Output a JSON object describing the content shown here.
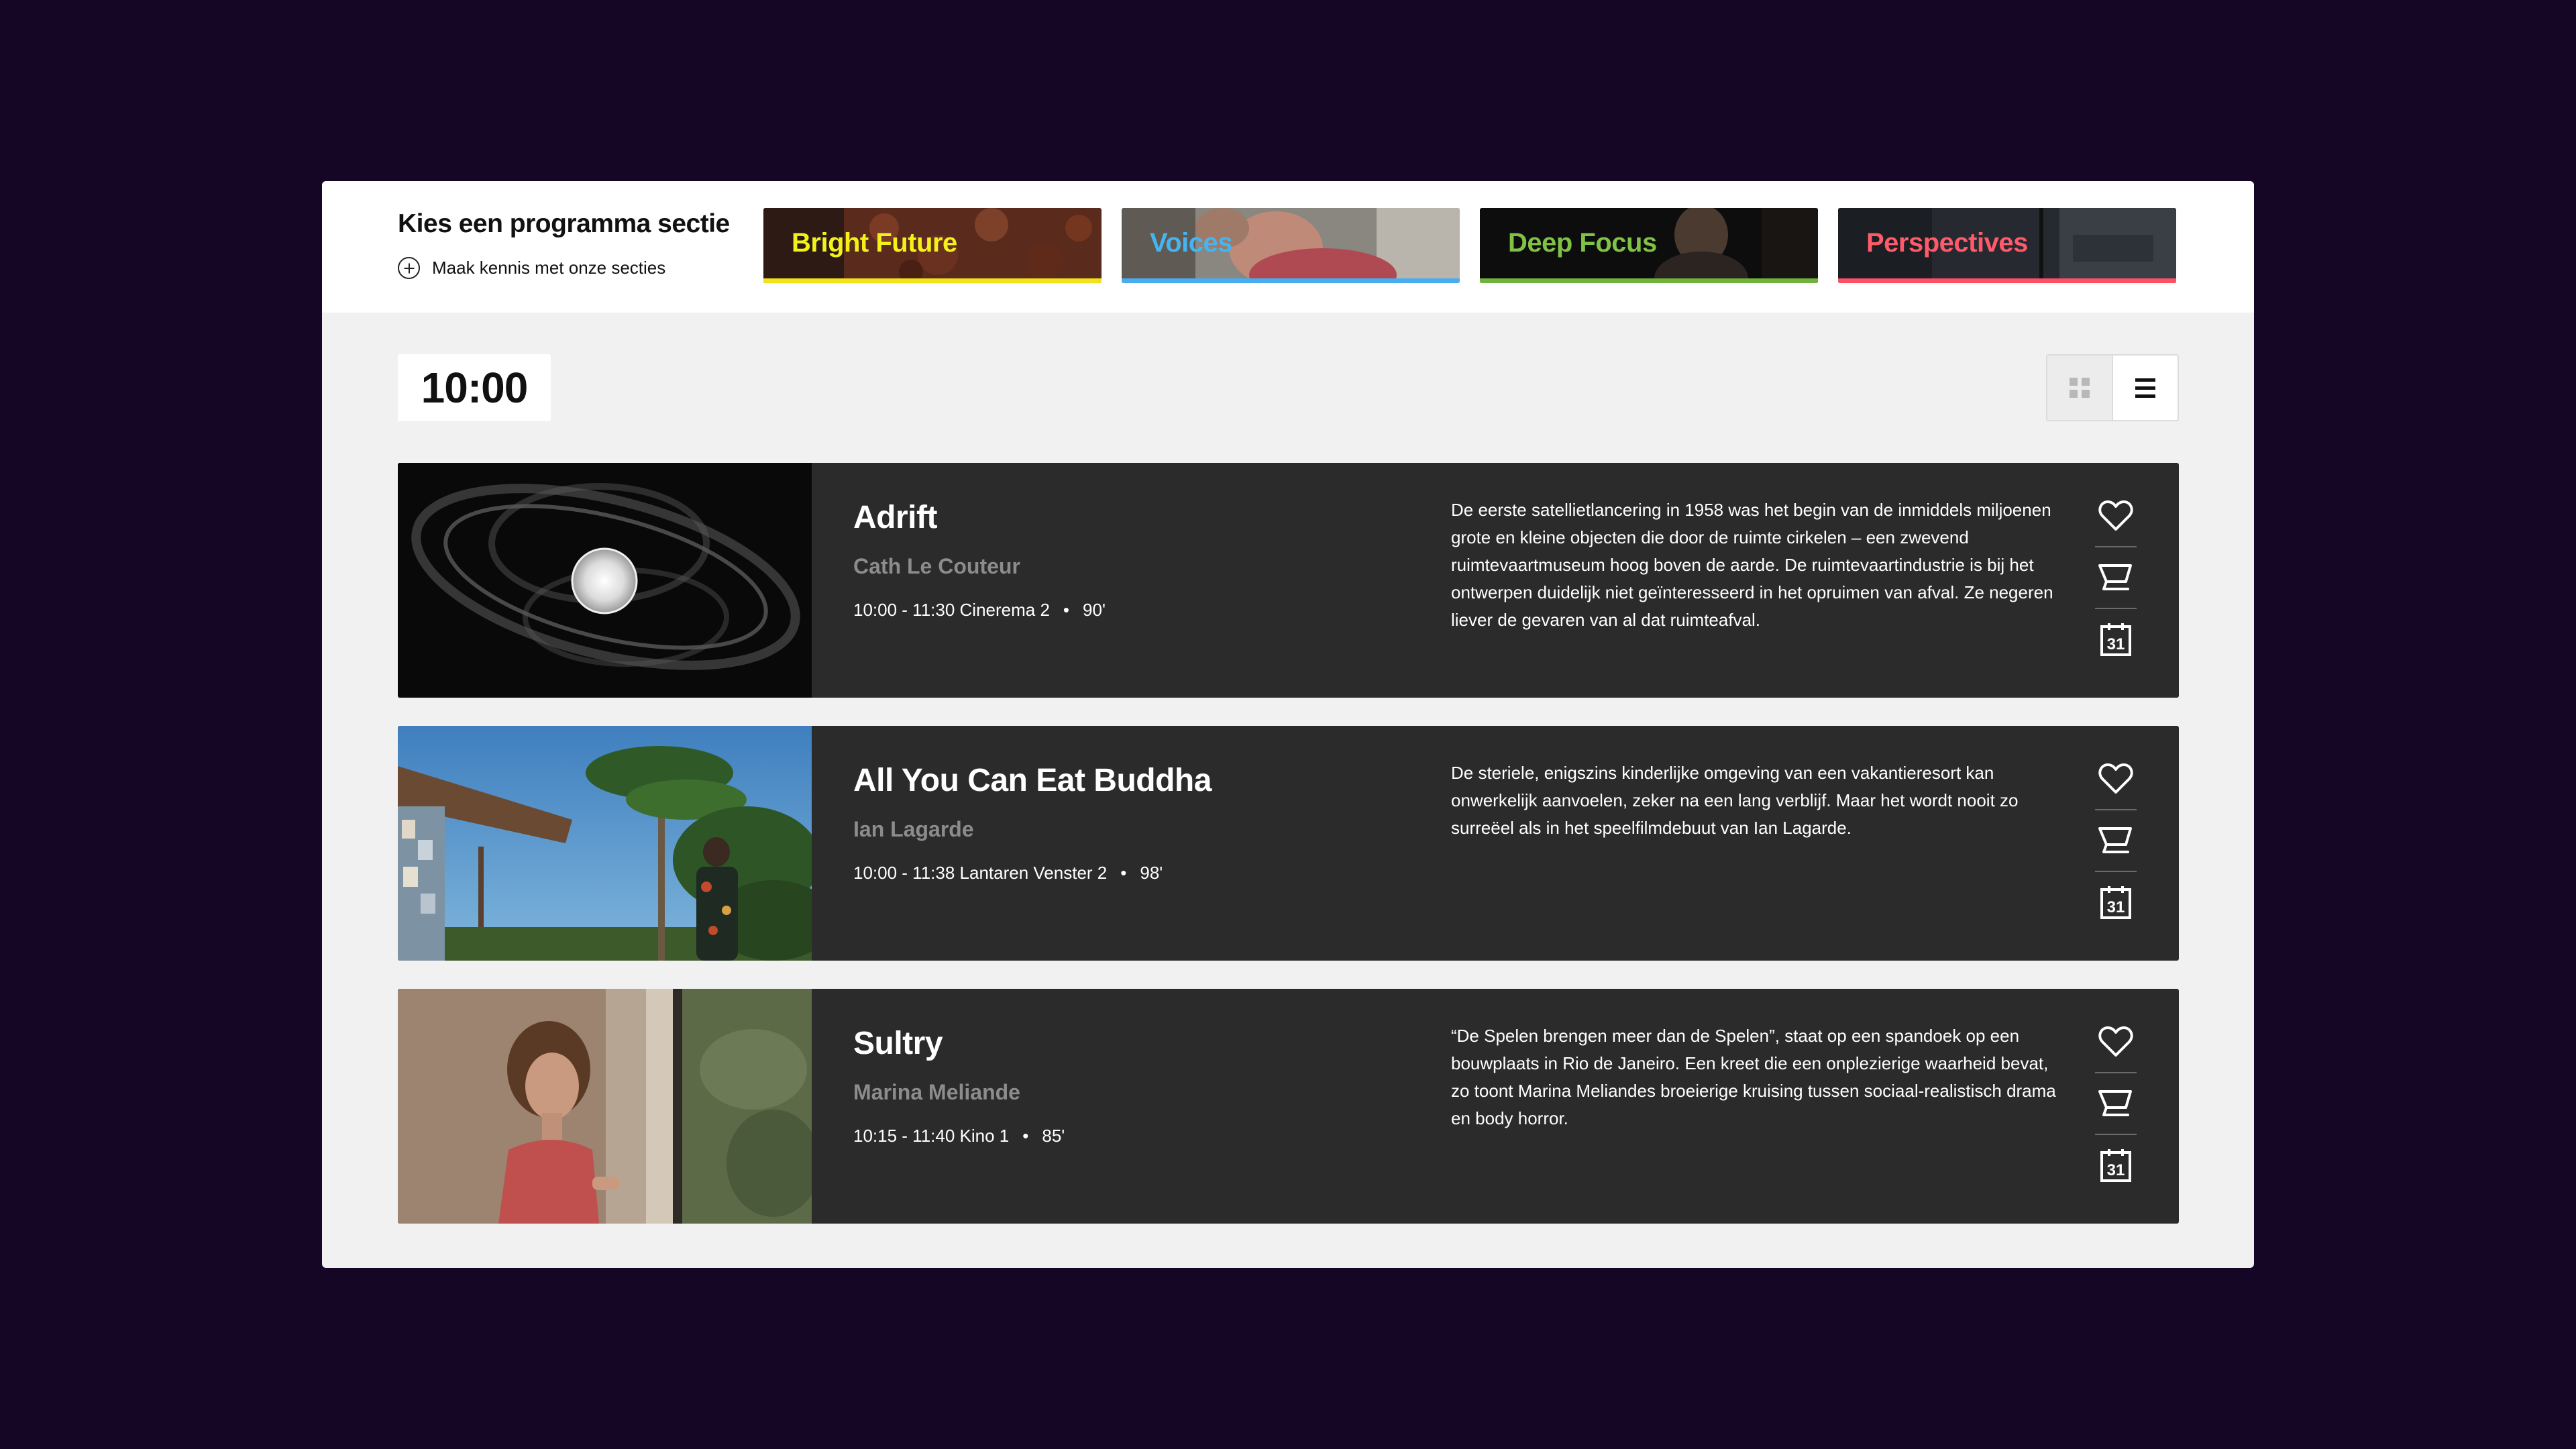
{
  "header": {
    "title": "Kies een programma sectie",
    "link_label": "Maak kennis met onze secties",
    "sections": [
      {
        "label": "Bright Future",
        "label_color": "#f2f21a",
        "accent": "#f2e21a"
      },
      {
        "label": "Voices",
        "label_color": "#46b4f0",
        "accent": "#46aef0"
      },
      {
        "label": "Deep Focus",
        "label_color": "#7fc246",
        "accent": "#6fb33c"
      },
      {
        "label": "Perspectives",
        "label_color": "#ff5a6a",
        "accent": "#ff4f66"
      }
    ]
  },
  "schedule": {
    "time": "10:00",
    "view_modes": {
      "grid": "grid-icon",
      "list": "list-icon",
      "active": "list"
    }
  },
  "films": [
    {
      "title": "Adrift",
      "director": "Cath Le Couteur",
      "screening": "10:00 - 11:30 Cinerema 2",
      "duration": "90'",
      "description": "De eerste satellietlancering in 1958 was het begin van de inmiddels miljoenen grote en kleine objecten die door de ruimte cirkelen – een zwevend ruimtevaartmuseum hoog boven de aarde. De ruimtevaartindustrie is bij het ontwerpen duidelijk niet geïnteresseerd in het opruimen van afval. Ze negeren liever de gevaren van al dat ruimteafval."
    },
    {
      "title": "All You Can Eat Buddha",
      "director": "Ian Lagarde",
      "screening": "10:00 - 11:38 Lantaren Venster 2",
      "duration": "98'",
      "description": "De steriele, enigszins kinderlijke omgeving van een vakantieresort kan onwerkelijk aanvoelen, zeker na een lang verblijf. Maar het wordt nooit zo surreëel als in het speelfilmdebuut van Ian Lagarde."
    },
    {
      "title": "Sultry",
      "director": "Marina Meliande",
      "screening": "10:15 - 11:40 Kino 1",
      "duration": "85'",
      "description": "“De Spelen brengen meer dan de Spelen”, staat op een spandoek op een bouwplaats in Rio de Janeiro. Een kreet die een onplezierige waarheid bevat, zo toont Marina Meliandes broeierige kruising tussen sociaal-realistisch drama en body horror."
    }
  ],
  "actions": {
    "favorite_icon": "heart-icon",
    "cart_icon": "cart-icon",
    "calendar_icon": "calendar-icon",
    "calendar_day": "31"
  },
  "colors": {
    "background": "#150626",
    "card": "#2b2b2b",
    "panel": "#f1f1f1"
  }
}
